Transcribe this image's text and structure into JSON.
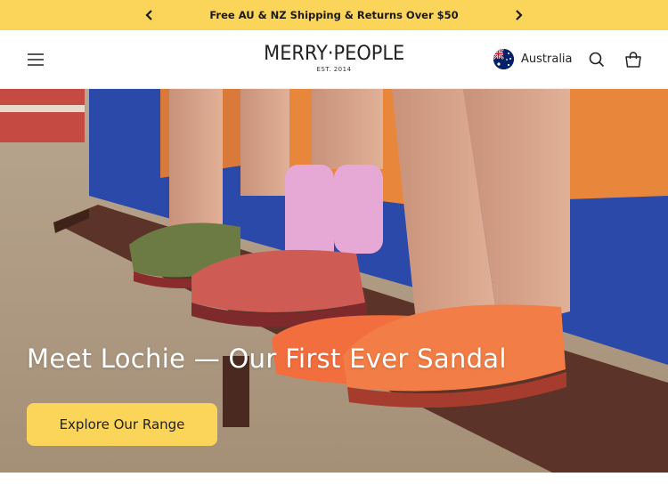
{
  "announcement": {
    "text": "Free AU & NZ Shipping & Returns Over $50",
    "prev_icon": "chevron-left-icon",
    "next_icon": "chevron-right-icon",
    "background": "#fbd45a"
  },
  "header": {
    "menu_icon": "hamburger-menu-icon",
    "logo": {
      "brand": "MERRY·PEOPLE",
      "est": "EST. 2014"
    },
    "country": {
      "label": "Australia",
      "flag_icon": "australia-flag-icon"
    },
    "search_icon": "search-icon",
    "cart_icon": "shopping-bag-icon"
  },
  "hero": {
    "headline": "Meet Lochie — Our First Ever Sandal",
    "cta_label": "Explore Our Range",
    "cta_color": "#fbd45a"
  }
}
